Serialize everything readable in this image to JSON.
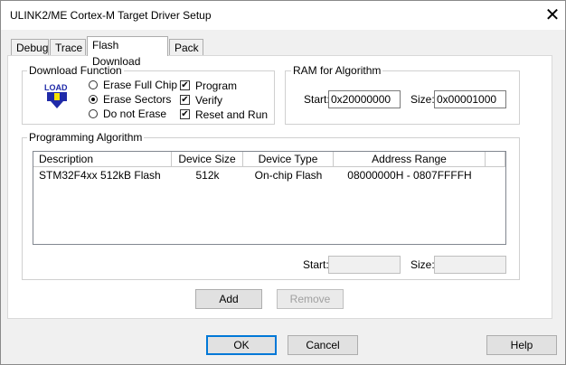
{
  "window": {
    "title": "ULINK2/ME Cortex-M Target Driver Setup",
    "close_glyph": "✕"
  },
  "tabs": [
    {
      "label": "Debug",
      "active": false
    },
    {
      "label": "Trace",
      "active": false
    },
    {
      "label": "Flash Download",
      "active": true
    },
    {
      "label": "Pack",
      "active": false
    }
  ],
  "download_function": {
    "title": "Download Function",
    "icon_text": "LOAD",
    "erase_options": [
      {
        "label": "Erase Full Chip",
        "selected": false
      },
      {
        "label": "Erase Sectors",
        "selected": true
      },
      {
        "label": "Do not Erase",
        "selected": false
      }
    ],
    "checks": [
      {
        "label": "Program",
        "checked": true
      },
      {
        "label": "Verify",
        "checked": true
      },
      {
        "label": "Reset and Run",
        "checked": true
      }
    ]
  },
  "ram_for_algorithm": {
    "title": "RAM for Algorithm",
    "start_label": "Start:",
    "start_value": "0x20000000",
    "size_label": "Size:",
    "size_value": "0x00001000"
  },
  "programming_algorithm": {
    "title": "Programming Algorithm",
    "columns": [
      "Description",
      "Device Size",
      "Device Type",
      "Address Range"
    ],
    "rows": [
      {
        "description": "STM32F4xx 512kB Flash",
        "device_size": "512k",
        "device_type": "On-chip Flash",
        "address_range": "08000000H - 0807FFFFH"
      }
    ],
    "start_label": "Start:",
    "start_value": "",
    "size_label": "Size:",
    "size_value": "",
    "add_label": "Add",
    "remove_label": "Remove"
  },
  "footer": {
    "ok_label": "OK",
    "cancel_label": "Cancel",
    "help_label": "Help"
  },
  "colors": {
    "accent": "#0078d7",
    "icon_blue": "#1f2aa8",
    "icon_yellow": "#f5e100"
  }
}
